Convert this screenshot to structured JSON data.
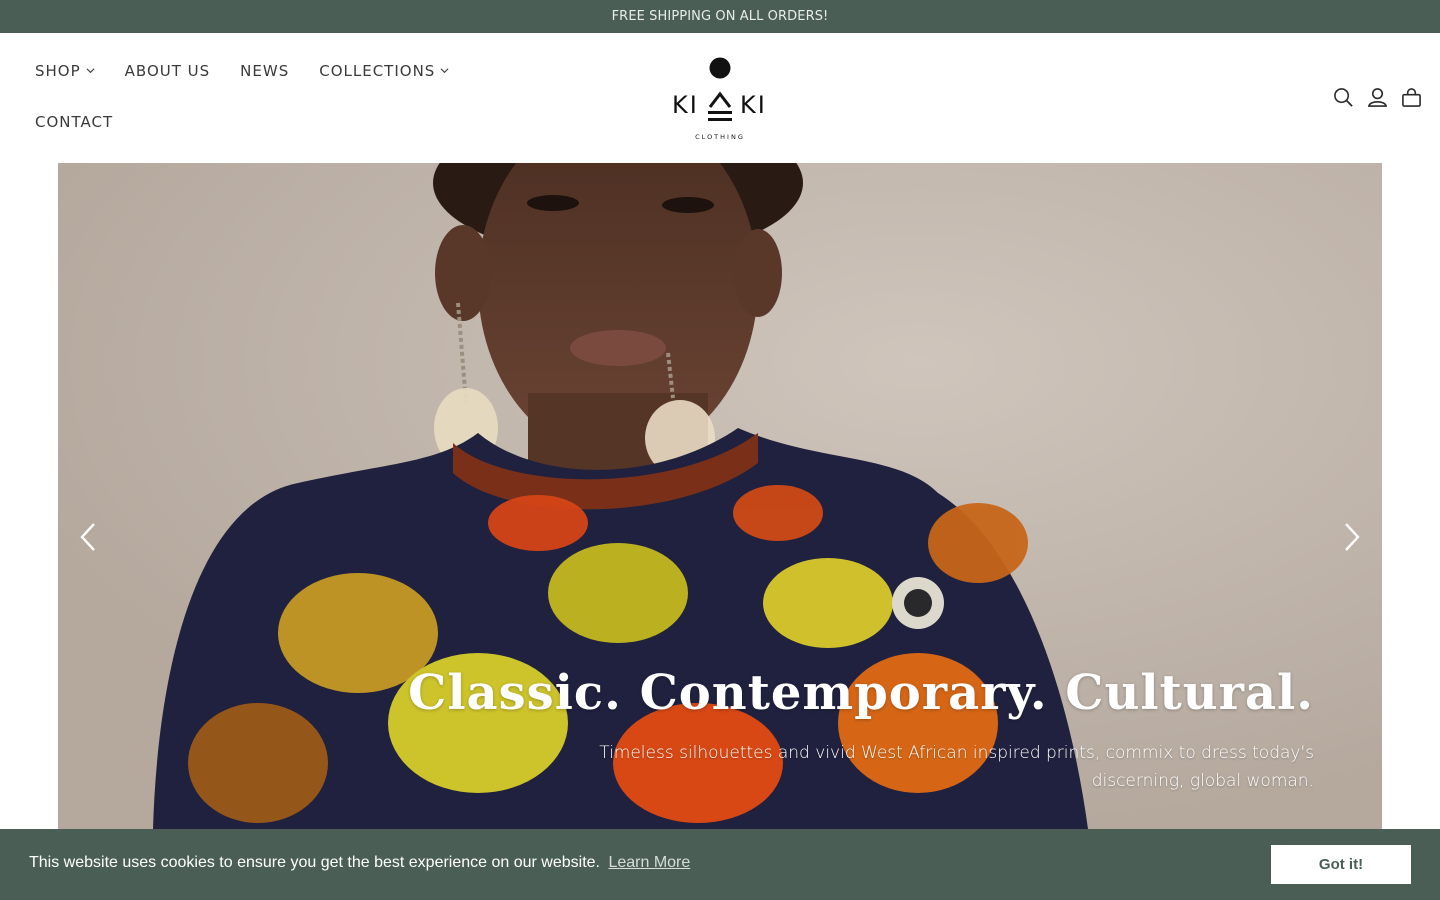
{
  "announcement": {
    "text": "FREE SHIPPING ON ALL ORDERS!"
  },
  "nav": {
    "items": [
      {
        "label": "SHOP",
        "has_dropdown": true
      },
      {
        "label": "ABOUT US",
        "has_dropdown": false
      },
      {
        "label": "NEWS",
        "has_dropdown": false
      },
      {
        "label": "COLLECTIONS",
        "has_dropdown": true
      },
      {
        "label": "CONTACT",
        "has_dropdown": false
      }
    ]
  },
  "logo": {
    "wordmark": "KI KI",
    "tagline": "CLOTHING"
  },
  "header_icons": [
    "search-icon",
    "account-icon",
    "cart-icon"
  ],
  "hero": {
    "title": "Classic. Contemporary. Cultural.",
    "subtitle": "Timeless silhouettes and vivid West African inspired prints, commix to dress today's discerning, global woman.",
    "prev_icon": "chevron-left-icon",
    "next_icon": "chevron-right-icon"
  },
  "cookie": {
    "message": "This website uses cookies to ensure you get the best experience on our website.",
    "link_label": "Learn More",
    "button_label": "Got it!"
  },
  "colors": {
    "brand_green": "#4a5e55",
    "hero_background": "#c6bbb1",
    "text_dark": "#3a3a3a"
  }
}
